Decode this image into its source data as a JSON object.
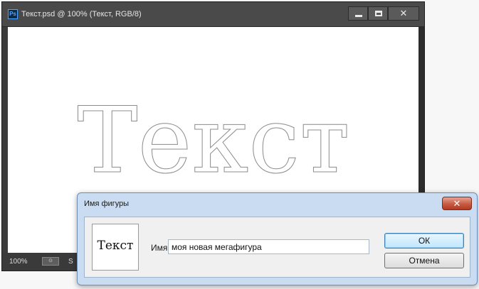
{
  "ps_window": {
    "logo": "Ps",
    "title": "Текст.psd @ 100% (Текст, RGB/8)",
    "minimize_icon": "minimize-icon",
    "maximize_icon": "maximize-icon",
    "close_label": "✕",
    "canvas_text": "Текст",
    "statusbar": {
      "zoom": "100%",
      "status_icon_label": "⊙",
      "extra_text": "S"
    }
  },
  "dialog": {
    "title": "Имя фигуры",
    "close_label": "✕",
    "preview_text": "Текст",
    "name_label": "Имя:",
    "name_value": "моя новая мегафигура",
    "ok_label": "ОК",
    "cancel_label": "Отмена"
  },
  "colors": {
    "ps_chrome": "#3c3c3c",
    "canvas_bg": "#ffffff",
    "dialog_frame": "#c9dcf1",
    "dialog_close": "#c75b43",
    "ok_accent": "#3c7fb1"
  }
}
